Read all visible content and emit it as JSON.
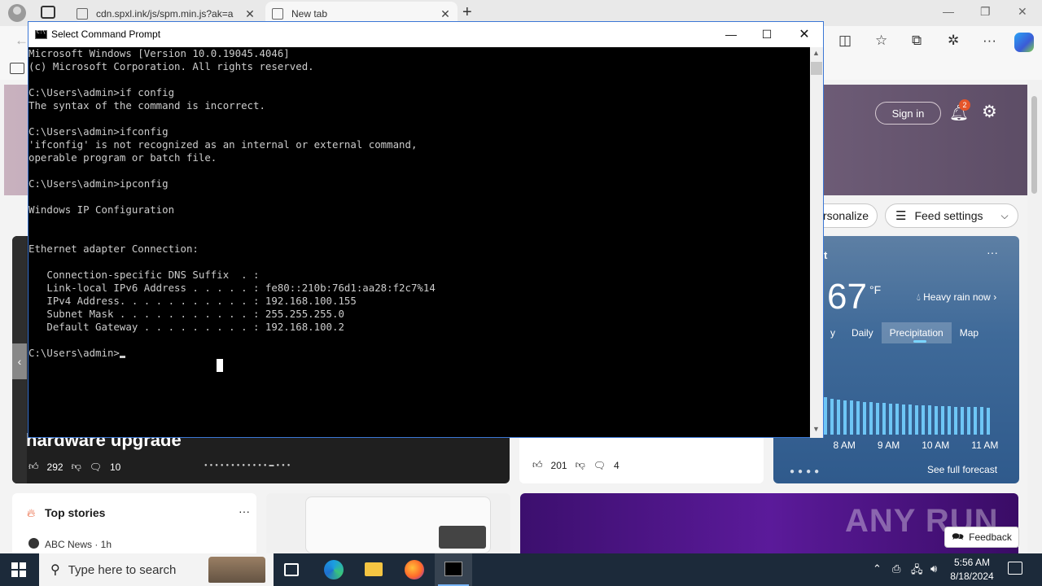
{
  "browser": {
    "tabs": [
      {
        "title": "cdn.spxl.ink/js/spm.min.js?ak=a",
        "close": "✕"
      },
      {
        "title": "New tab",
        "close": "✕"
      }
    ],
    "new_tab": "+",
    "window_controls": {
      "minimize": "—",
      "restore": "❐",
      "close": "✕"
    }
  },
  "page": {
    "sign_in": "Sign in",
    "notifications_count": "2",
    "personalize": "ersonalize",
    "feed_settings": "Feed settings",
    "weather": {
      "location": "rt",
      "temperature": "67",
      "unit": "°F",
      "condition": "Heavy rain now",
      "tabs": [
        "y",
        "Daily",
        "Precipitation",
        "Map"
      ],
      "times": [
        "8 AM",
        "9 AM",
        "10 AM",
        "11 AM"
      ],
      "see_forecast": "See full forecast"
    },
    "news_main": {
      "headline": "hardware upgrade",
      "likes": "292",
      "comments": "10"
    },
    "news_second": {
      "likes": "201",
      "comments": "4"
    },
    "top_stories": {
      "title": "Top stories",
      "more": "···",
      "source": "ABC News · 1h"
    },
    "feedback": "Feedback",
    "watermark": "ANY RUN"
  },
  "cmd": {
    "title": "Select Command Prompt",
    "lines": [
      "Microsoft Windows [Version 10.0.19045.4046]",
      "(c) Microsoft Corporation. All rights reserved.",
      "",
      "C:\\Users\\admin>if config",
      "The syntax of the command is incorrect.",
      "",
      "C:\\Users\\admin>ifconfig",
      "'ifconfig' is not recognized as an internal or external command,",
      "operable program or batch file.",
      "",
      "C:\\Users\\admin>ipconfig",
      "",
      "Windows IP Configuration",
      "",
      "",
      "Ethernet adapter Connection:",
      "",
      "   Connection-specific DNS Suffix  . :",
      "   Link-local IPv6 Address . . . . . : fe80::210b:76d1:aa28:f2c7%14",
      "   IPv4 Address. . . . . . . . . . . : 192.168.100.155",
      "   Subnet Mask . . . . . . . . . . . : 255.255.255.0",
      "   Default Gateway . . . . . . . . . : 192.168.100.2",
      ""
    ],
    "prompt": "C:\\Users\\admin>"
  },
  "taskbar": {
    "search_placeholder": "Type here to search",
    "time": "5:56 AM",
    "date": "8/18/2024"
  }
}
